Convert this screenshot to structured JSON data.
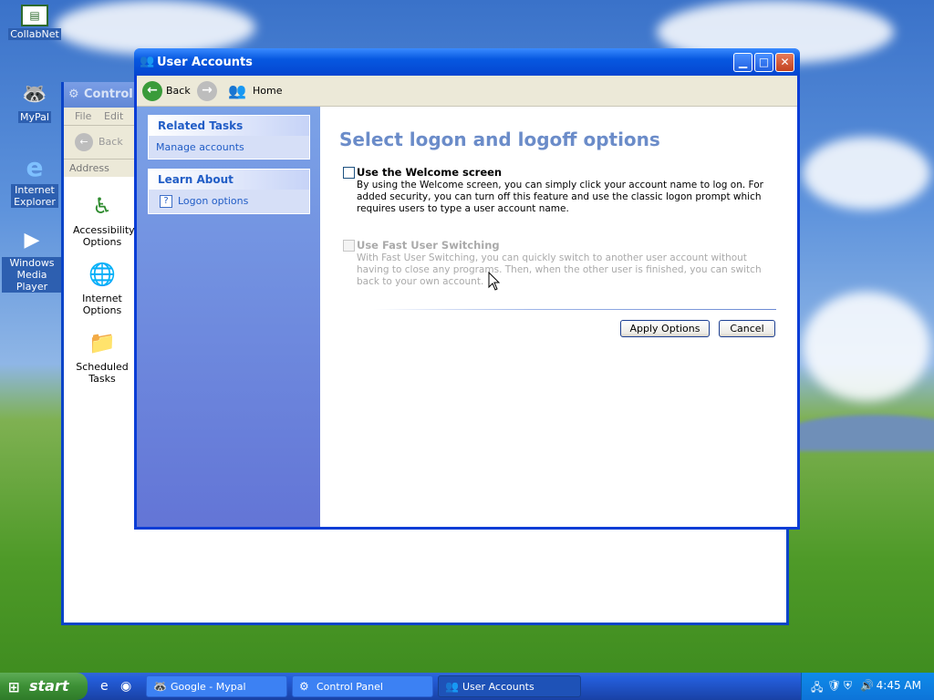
{
  "desktop": {
    "icons": [
      {
        "label": "CollabNet",
        "icon": "collabnet-icon"
      },
      {
        "label": "MyPal",
        "icon": "mypal-icon"
      },
      {
        "label": "Internet Explorer",
        "icon": "internet-explorer-icon"
      },
      {
        "label": "Windows Media Player",
        "icon": "windows-media-player-icon"
      }
    ]
  },
  "control_panel": {
    "title": "Control P",
    "menu": [
      "File",
      "Edit"
    ],
    "back_label": "Back",
    "address_label": "Address",
    "items": [
      {
        "label": "Accessibility Options",
        "icon": "accessibility-icon"
      },
      {
        "label": "Internet Options",
        "icon": "internet-options-icon"
      },
      {
        "label": "Scheduled Tasks",
        "icon": "scheduled-tasks-icon"
      }
    ]
  },
  "user_accounts": {
    "title": "User Accounts",
    "nav": {
      "back": "Back",
      "home": "Home"
    },
    "related_tasks": {
      "heading": "Related Tasks",
      "items": [
        "Manage accounts"
      ]
    },
    "learn_about": {
      "heading": "Learn About",
      "items": [
        "Logon options"
      ]
    },
    "heading": "Select logon and logoff options",
    "options": [
      {
        "title": "Use the Welcome screen",
        "checked": false,
        "enabled": true,
        "description": "By using the Welcome screen, you can simply click your account name to log on. For added security, you can turn off this feature and use the classic logon prompt which requires users to type a user account name."
      },
      {
        "title": "Use Fast User Switching",
        "checked": false,
        "enabled": false,
        "description": "With Fast User Switching, you can quickly switch to another user account without having to close any programs. Then, when the other user is finished, you can switch back to your own account."
      }
    ],
    "apply_label": "Apply Options",
    "cancel_label": "Cancel"
  },
  "taskbar": {
    "start_label": "start",
    "tasks": [
      {
        "label": "Google - Mypal",
        "icon": "mypal-icon",
        "active": false
      },
      {
        "label": "Control Panel",
        "icon": "control-panel-icon",
        "active": false
      },
      {
        "label": "User Accounts",
        "icon": "user-accounts-icon",
        "active": true
      }
    ],
    "clock": "4:45 AM"
  },
  "colors": {
    "title_bar": "#0758e0",
    "task_pane": "#7ba2e7",
    "heading_text": "#6b8cc9",
    "link_text": "#215dc6",
    "start_green": "#3c8f35"
  }
}
